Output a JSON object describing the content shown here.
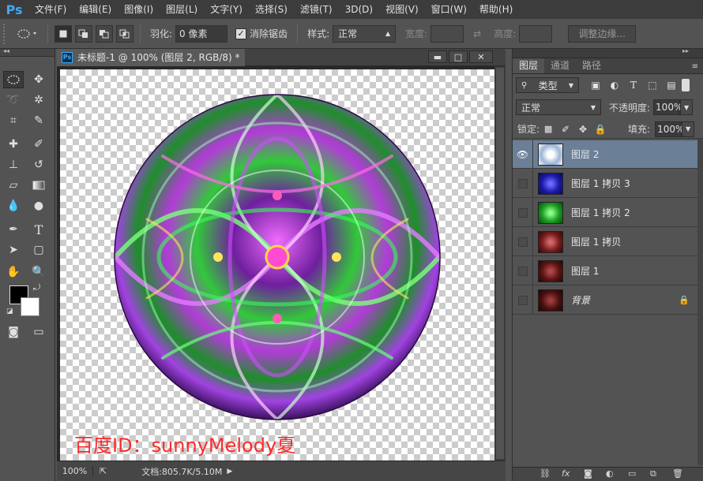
{
  "app": {
    "logo": "Ps"
  },
  "menu": [
    "文件(F)",
    "编辑(E)",
    "图像(I)",
    "图层(L)",
    "文字(Y)",
    "选择(S)",
    "滤镜(T)",
    "3D(D)",
    "视图(V)",
    "窗口(W)",
    "帮助(H)"
  ],
  "options": {
    "feather_label": "羽化:",
    "feather_value": "0 像素",
    "antialias_label": "消除锯齿",
    "antialias_checked": true,
    "style_label": "样式:",
    "style_value": "正常",
    "width_label": "宽度:",
    "height_label": "高度:",
    "refine_edge_label": "调整边缘..."
  },
  "document": {
    "tab_title": "未标题-1 @ 100% (图层 2, RGB/8) *",
    "zoom": "100%",
    "doc_info": "文档:805.7K/5.10M",
    "watermark": "百度ID：sunnyMelody夏"
  },
  "layers_panel": {
    "tabs": [
      "图层",
      "通道",
      "路径"
    ],
    "active_tab": 0,
    "filter_kind": "类型",
    "blend_mode": "正常",
    "opacity_label": "不透明度:",
    "opacity_value": "100%",
    "lock_label": "锁定:",
    "fill_label": "填充:",
    "fill_value": "100%",
    "layers": [
      {
        "name": "图层 2",
        "visible": true,
        "selected": true,
        "locked": false,
        "thumb": "#9cb4d8"
      },
      {
        "name": "图层 1 拷贝 3",
        "visible": false,
        "selected": false,
        "locked": false,
        "thumb": "#1a1aa8"
      },
      {
        "name": "图层 1 拷贝 2",
        "visible": false,
        "selected": false,
        "locked": false,
        "thumb": "#1c9c22"
      },
      {
        "name": "图层 1 拷贝",
        "visible": false,
        "selected": false,
        "locked": false,
        "thumb": "#7a1c1c"
      },
      {
        "name": "图层 1",
        "visible": false,
        "selected": false,
        "locked": false,
        "thumb": "#5a1414"
      },
      {
        "name": "背景",
        "visible": false,
        "selected": false,
        "locked": true,
        "thumb": "#4a1010"
      }
    ]
  },
  "colors": {
    "foreground": "#000000",
    "background": "#ffffff",
    "accent": "#6b7f96",
    "ps_blue": "#3fa9f5"
  }
}
